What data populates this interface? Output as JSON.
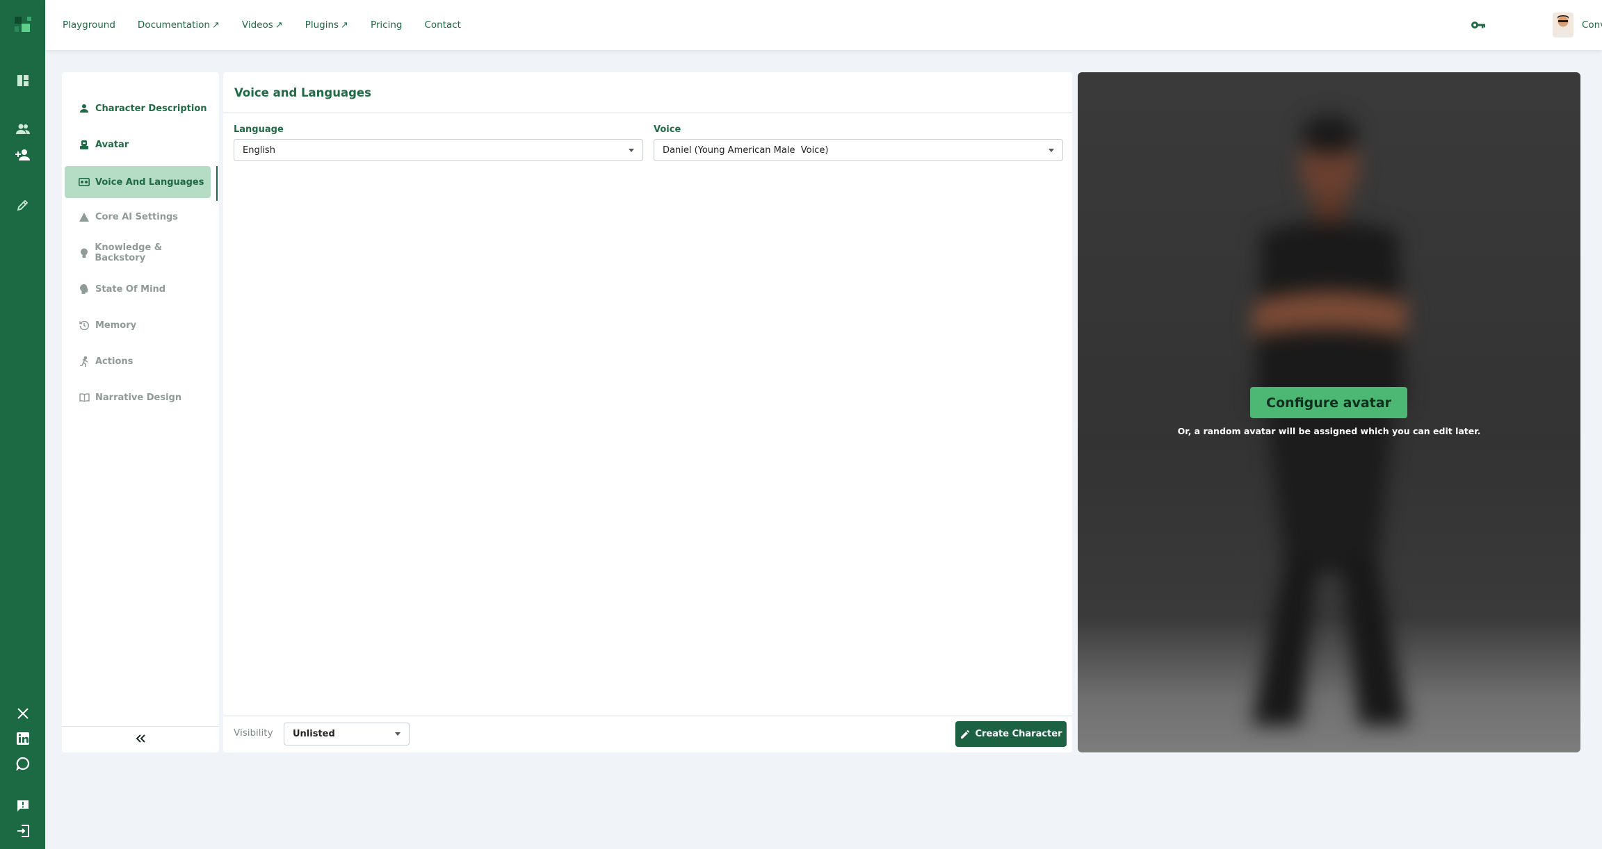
{
  "app": {
    "brand_color": "#1b6a43",
    "accent": "#4cb874",
    "active_bg": "#b5dcc4"
  },
  "topnav": {
    "items": [
      {
        "label": "Playground",
        "external": ""
      },
      {
        "label": "Documentation",
        "external": "↗"
      },
      {
        "label": "Videos",
        "external": "↗"
      },
      {
        "label": "Plugins",
        "external": "↗"
      },
      {
        "label": "Pricing",
        "external": ""
      },
      {
        "label": "Contact",
        "external": ""
      }
    ],
    "user": {
      "name": "Convai"
    }
  },
  "rail": {
    "icons": [
      "logo-icon",
      "dashboard-icon",
      "characters-icon",
      "add-character-icon",
      "edit-icon",
      "x-twitter-icon",
      "linkedin-icon",
      "discord-icon",
      "feedback-icon",
      "logout-icon"
    ]
  },
  "sidebar": {
    "items": [
      {
        "label": "Character Description",
        "icon": "person-icon",
        "state": "enabled"
      },
      {
        "label": "Avatar",
        "icon": "avatar-icon",
        "state": "enabled"
      },
      {
        "label": "Voice And Languages",
        "icon": "voice-icon",
        "state": "active"
      },
      {
        "label": "Core AI Settings",
        "icon": "warning-icon",
        "state": "disabled"
      },
      {
        "label": "Knowledge & Backstory",
        "icon": "bulb-icon",
        "state": "disabled"
      },
      {
        "label": "State Of Mind",
        "icon": "mind-icon",
        "state": "disabled"
      },
      {
        "label": "Memory",
        "icon": "history-icon",
        "state": "disabled"
      },
      {
        "label": "Actions",
        "icon": "run-icon",
        "state": "disabled"
      },
      {
        "label": "Narrative Design",
        "icon": "book-icon",
        "state": "disabled"
      }
    ],
    "collapse_label": "«"
  },
  "main": {
    "title": "Voice and Languages",
    "language": {
      "label": "Language",
      "value": "English"
    },
    "voice": {
      "label": "Voice",
      "value": "Daniel (Young American Male  Voice)"
    },
    "visibility": {
      "label": "Visibility",
      "value": "Unlisted"
    },
    "create_button": "Create Character"
  },
  "preview": {
    "configure_button": "Configure avatar",
    "note": "Or, a random avatar will be assigned which you can edit later."
  }
}
